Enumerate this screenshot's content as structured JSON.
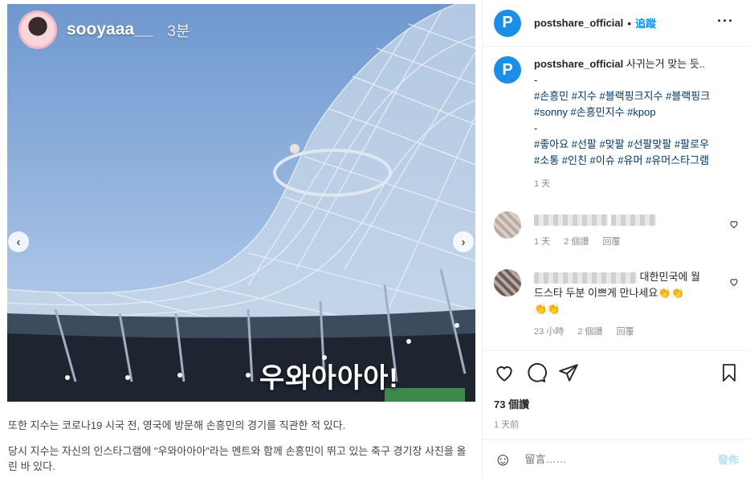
{
  "media": {
    "story_username": "sooyaaa__",
    "story_time": "3분",
    "overlay_text": "우와아아아!",
    "article_lines": [
      "또한 지수는 코로나19 시국 전, 영국에 방문해 손흥민의 경기를 직관한 적 있다.",
      "당시 지수는 자신의 인스타그램에 \"우와아아아\"라는 멘트와 함께 손흥민이 뛰고 있는 축구 경기장 사진을 올린 바 있다."
    ],
    "prev_glyph": "‹",
    "next_glyph": "›"
  },
  "header": {
    "username": "postshare_official",
    "follow_label": "追蹤",
    "logo_glyph": "P",
    "more_label": "···",
    "dot": "•"
  },
  "caption": {
    "username": "postshare_official",
    "text": "사귀는거 맞는 듯..",
    "dash1": "-",
    "tags1a": "#손흥민 #지수 #블랙핑크지수 #블랙핑크",
    "tags1b": "#sonny #손흥민지수 #kpop",
    "dash2": "-",
    "tags2a": "#좋아요 #선팔 #맞팔 #선팔맞팔 #팔로우",
    "tags2b": "#소통 #인친 #이슈 #유머 #유머스타그램",
    "time": "1 天"
  },
  "comments": [
    {
      "time": "1 天",
      "likes": "2 個讚",
      "reply": "回覆"
    },
    {
      "text_a": "대한민국에 월",
      "text_b": "드스타 두분 이쁘게 만나세요👏👏",
      "text_c": "👏👏",
      "time": "23 小時",
      "likes": "2 個讚",
      "reply": "回覆"
    }
  ],
  "actions": {
    "likes": "73 個讚",
    "posted": "1 天前"
  },
  "comment_box": {
    "emoji": "☺",
    "placeholder": "留言……",
    "post_label": "發佈"
  }
}
